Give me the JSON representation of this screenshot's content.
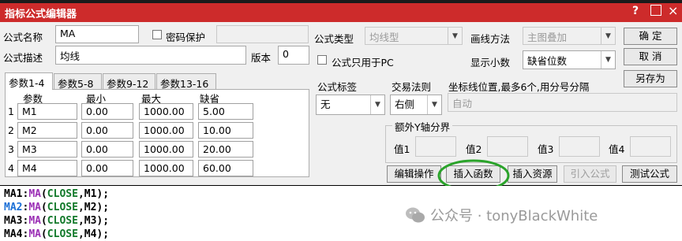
{
  "window": {
    "title": "指标公式编辑器",
    "help_glyph": "?",
    "close_glyph": "×"
  },
  "form": {
    "name_label": "公式名称",
    "name_value": "MA",
    "password_label": "密码保护",
    "password_checked": false,
    "desc_label": "公式描述",
    "desc_value": "均线",
    "version_label": "版本",
    "version_value": "0",
    "type_label": "公式类型",
    "type_value": "均线型",
    "pc_only_label": "公式只用于PC",
    "pc_only_checked": false,
    "draw_method_label": "画线方法",
    "draw_method_value": "主图叠加",
    "decimals_label": "显示小数",
    "decimals_value": "缺省位数"
  },
  "buttons": {
    "ok": "确  定",
    "cancel": "取  消",
    "save_as": "另存为",
    "edit_ops": "编辑操作",
    "insert_func": "插入函数",
    "insert_res": "插入资源",
    "import_formula": "引入公式",
    "test_formula": "测试公式"
  },
  "params": {
    "tabs": [
      "参数1-4",
      "参数5-8",
      "参数9-12",
      "参数13-16"
    ],
    "active_tab": 0,
    "headers": [
      "参数",
      "最小",
      "最大",
      "缺省"
    ],
    "rows": [
      {
        "index": "1",
        "name": "M1",
        "min": "0.00",
        "max": "1000.00",
        "default": "5.00"
      },
      {
        "index": "2",
        "name": "M2",
        "min": "0.00",
        "max": "1000.00",
        "default": "10.00"
      },
      {
        "index": "3",
        "name": "M3",
        "min": "0.00",
        "max": "1000.00",
        "default": "20.00"
      },
      {
        "index": "4",
        "name": "M4",
        "min": "0.00",
        "max": "1000.00",
        "default": "60.00"
      }
    ]
  },
  "tags": {
    "formula_tag_label": "公式标签",
    "formula_tag_value": "无",
    "trade_rule_label": "交易法则",
    "trade_rule_value": "右侧",
    "axis_pos_label": "坐标线位置,最多6个,用分号分隔",
    "axis_pos_value": "自动",
    "y_axis_group_label": "额外Y轴分界",
    "y_values": [
      "值1",
      "值2",
      "值3",
      "值4"
    ]
  },
  "editor": {
    "lines": [
      {
        "var": "MA1",
        "func": "MA",
        "arg": "CLOSE",
        "param": "M1"
      },
      {
        "var": "MA2",
        "func": "MA",
        "arg": "CLOSE",
        "param": "M2"
      },
      {
        "var": "MA3",
        "func": "MA",
        "arg": "CLOSE",
        "param": "M3"
      },
      {
        "var": "MA4",
        "func": "MA",
        "arg": "CLOSE",
        "param": "M4"
      }
    ],
    "var_colors": [
      "#000000",
      "#1a6fd6",
      "#000000",
      "#000000"
    ],
    "func_color": "#9b2fb5",
    "arg_color": "#137a2b"
  },
  "watermark": {
    "text": "公众号 · tonyBlackWhite"
  },
  "colors": {
    "titlebar": "#cd2b2b",
    "highlight_circle": "#2aa32a"
  }
}
